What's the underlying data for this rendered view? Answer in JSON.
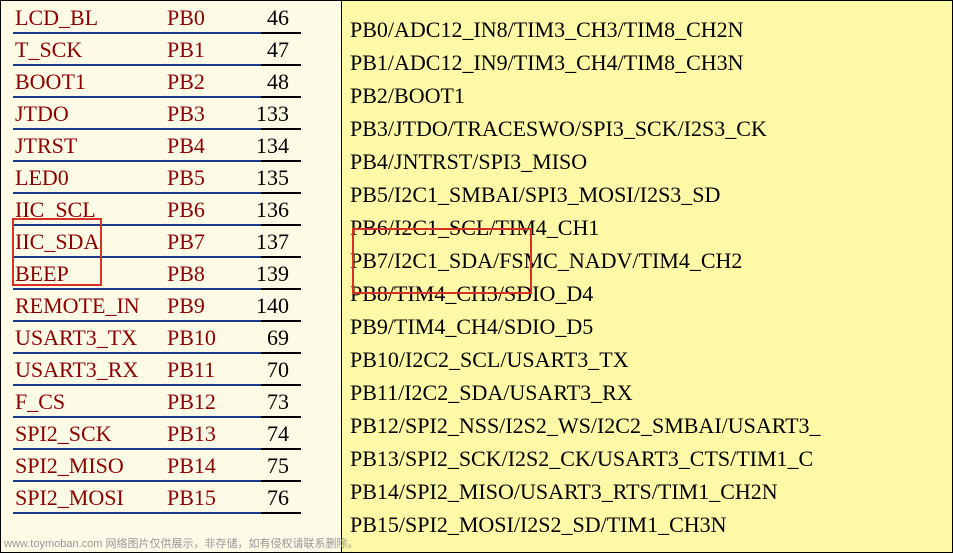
{
  "pins": [
    {
      "label": "LCD_BL",
      "port": "PB0",
      "num": "46"
    },
    {
      "label": "T_SCK",
      "port": "PB1",
      "num": "47"
    },
    {
      "label": "BOOT1",
      "port": "PB2",
      "num": "48"
    },
    {
      "label": "JTDO",
      "port": "PB3",
      "num": "133"
    },
    {
      "label": "JTRST",
      "port": "PB4",
      "num": "134"
    },
    {
      "label": "LED0",
      "port": "PB5",
      "num": "135"
    },
    {
      "label": "IIC_SCL",
      "port": "PB6",
      "num": "136"
    },
    {
      "label": "IIC_SDA",
      "port": "PB7",
      "num": "137"
    },
    {
      "label": "BEEP",
      "port": "PB8",
      "num": "139"
    },
    {
      "label": "REMOTE_IN",
      "port": "PB9",
      "num": "140"
    },
    {
      "label": "USART3_TX",
      "port": "PB10",
      "num": "69"
    },
    {
      "label": "USART3_RX",
      "port": "PB11",
      "num": "70"
    },
    {
      "label": "F_CS",
      "port": "PB12",
      "num": "73"
    },
    {
      "label": "SPI2_SCK",
      "port": "PB13",
      "num": "74"
    },
    {
      "label": "SPI2_MISO",
      "port": "PB14",
      "num": "75"
    },
    {
      "label": "SPI2_MOSI",
      "port": "PB15",
      "num": "76"
    }
  ],
  "functions": [
    "PB0/ADC12_IN8/TIM3_CH3/TIM8_CH2N",
    "PB1/ADC12_IN9/TIM3_CH4/TIM8_CH3N",
    "PB2/BOOT1",
    "PB3/JTDO/TRACESWO/SPI3_SCK/I2S3_CK",
    "PB4/JNTRST/SPI3_MISO",
    "PB5/I2C1_SMBAI/SPI3_MOSI/I2S3_SD",
    "PB6/I2C1_SCL/TIM4_CH1",
    "PB7/I2C1_SDA/FSMC_NADV/TIM4_CH2",
    "PB8/TIM4_CH3/SDIO_D4",
    "PB9/TIM4_CH4/SDIO_D5",
    "PB10/I2C2_SCL/USART3_TX",
    "PB11/I2C2_SDA/USART3_RX",
    "PB12/SPI2_NSS/I2S2_WS/I2C2_SMBAI/USART3_",
    "PB13/SPI2_SCK/I2S2_CK/USART3_CTS/TIM1_C",
    "PB14/SPI2_MISO/USART3_RTS/TIM1_CH2N",
    "PB15/SPI2_MOSI/I2S2_SD/TIM1_CH3N"
  ],
  "watermark": "www.toymoban.com 网络图片仅供展示，非存储，如有侵权请联系删除。"
}
